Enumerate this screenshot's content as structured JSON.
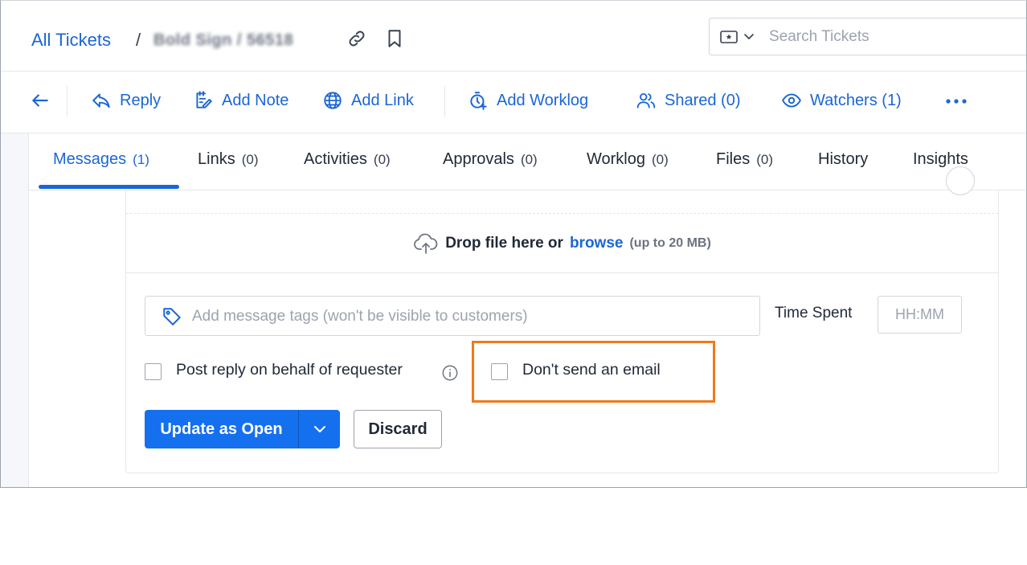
{
  "header": {
    "breadcrumb_all": "All Tickets",
    "breadcrumb_sep1": "/",
    "breadcrumb_redacted": "Bold Sign / 56518",
    "search_placeholder": "Search Tickets"
  },
  "toolbar": {
    "reply": "Reply",
    "add_note": "Add Note",
    "add_link": "Add Link",
    "add_worklog": "Add Worklog",
    "shared": "Shared (0)",
    "watchers": "Watchers (1)"
  },
  "tabs": [
    {
      "label": "Messages",
      "count": "(1)",
      "active": true
    },
    {
      "label": "Links",
      "count": "(0)"
    },
    {
      "label": "Activities",
      "count": "(0)"
    },
    {
      "label": "Approvals",
      "count": "(0)"
    },
    {
      "label": "Worklog",
      "count": "(0)"
    },
    {
      "label": "Files",
      "count": "(0)"
    },
    {
      "label": "History",
      "count": ""
    },
    {
      "label": "Insights",
      "count": ""
    }
  ],
  "compose": {
    "drop_text": "Drop file here or",
    "drop_browse": "browse",
    "drop_limit": "(up to 20 MB)",
    "tags_placeholder": "Add message tags (won't be visible to customers)",
    "time_label": "Time Spent",
    "time_placeholder": "HH:MM",
    "post_on_behalf": "Post reply on behalf of requester",
    "dont_send_email": "Don't send an email",
    "update_button": "Update as Open",
    "discard_button": "Discard"
  },
  "colors": {
    "accent": "#1a66d6",
    "primary_button": "#1470ef",
    "highlight": "#ee7a1c"
  }
}
